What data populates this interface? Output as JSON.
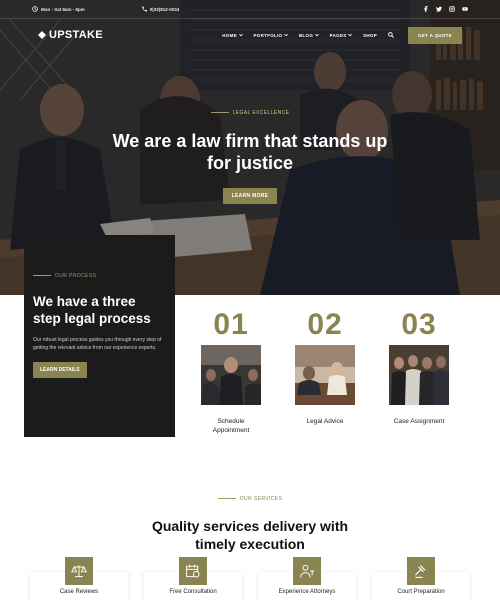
{
  "topbar": {
    "hours": "Mon - Sat 8am - 6pm",
    "phone": "0(33)812-0034",
    "social_icons": [
      "facebook-icon",
      "twitter-icon",
      "instagram-icon",
      "youtube-icon"
    ]
  },
  "nav": {
    "logo": "UPSTAKE",
    "items": [
      {
        "label": "HOME",
        "dropdown": true
      },
      {
        "label": "PORTFOLIO",
        "dropdown": true
      },
      {
        "label": "BLOG",
        "dropdown": true
      },
      {
        "label": "PAGES",
        "dropdown": true
      },
      {
        "label": "SHOP",
        "dropdown": false
      }
    ],
    "cta": "GET A QUOTE"
  },
  "hero": {
    "eyebrow": "LEGAL EXCELLENCE",
    "title": "We are a law firm that stands up for justice",
    "button": "LEARN MORE"
  },
  "process": {
    "eyebrow": "OUR PROCESS",
    "title": "We have a three step legal process",
    "text": "Our robust legal process guides you through every step of getting the relevant advice from our experience experts.",
    "button": "LEARN DETAILS"
  },
  "steps": [
    {
      "number": "01",
      "label": "Schedule Appointment"
    },
    {
      "number": "02",
      "label": "Legal Advice"
    },
    {
      "number": "03",
      "label": "Case Assignment"
    }
  ],
  "services": {
    "eyebrow": "OUR SERVICES",
    "title": "Quality services delivery with timely execution",
    "cards": [
      {
        "label": "Case Reviews",
        "icon": "scales-icon"
      },
      {
        "label": "Free Consultation",
        "icon": "calendar-clock-icon"
      },
      {
        "label": "Experience Attorneys",
        "icon": "attorney-icon"
      },
      {
        "label": "Court Preparation",
        "icon": "gavel-icon"
      }
    ]
  },
  "colors": {
    "accent": "#8a8451",
    "dark": "#1b1b1b"
  }
}
